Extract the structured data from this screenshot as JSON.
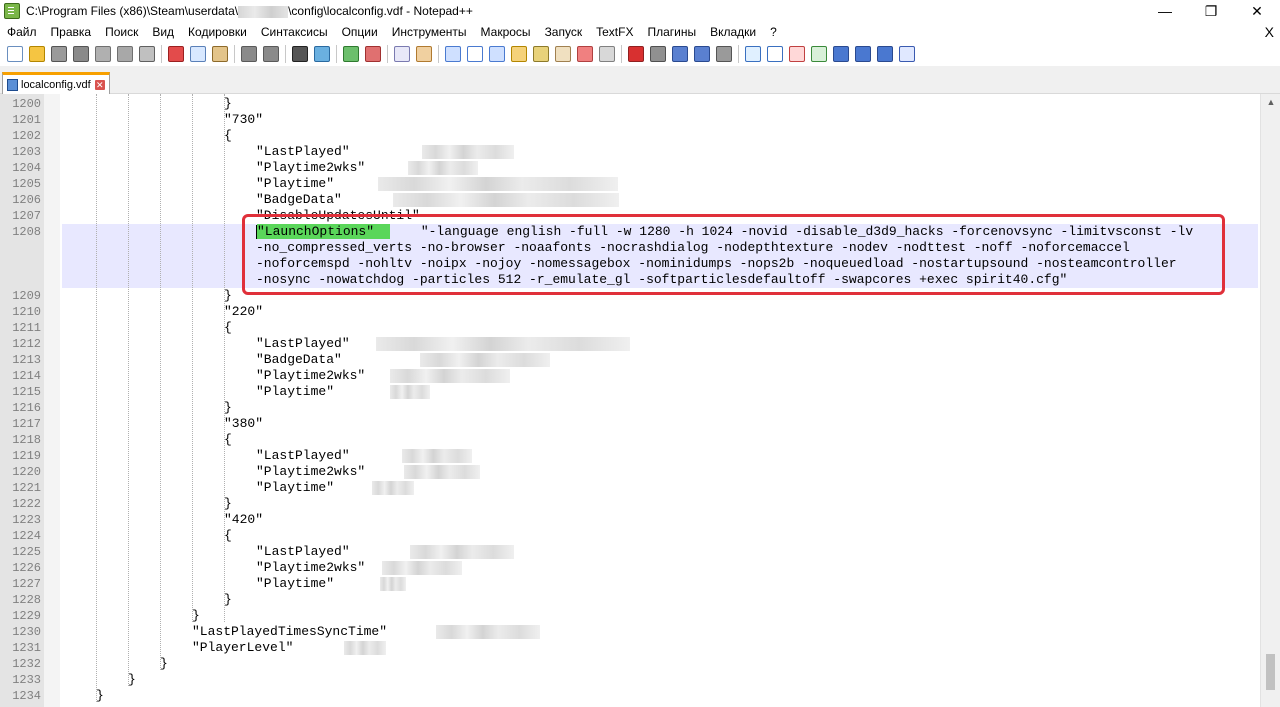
{
  "window": {
    "title_prefix": "C:\\Program Files (x86)\\Steam\\userdata\\",
    "title_suffix": "\\config\\localconfig.vdf - Notepad++",
    "minimize": "—",
    "maximize": "❐",
    "close": "✕"
  },
  "menu": {
    "items": [
      "Файл",
      "Правка",
      "Поиск",
      "Вид",
      "Кодировки",
      "Синтаксисы",
      "Опции",
      "Инструменты",
      "Макросы",
      "Запуск",
      "TextFX",
      "Плагины",
      "Вкладки",
      "?"
    ],
    "close_doc": "X"
  },
  "toolbar": {
    "icons": [
      {
        "name": "new-file-icon",
        "color": "#ffffff",
        "border": "#6a8fbf"
      },
      {
        "name": "open-file-icon",
        "color": "#f5c542",
        "border": "#b38600"
      },
      {
        "name": "save-icon",
        "color": "#9a9a9a",
        "border": "#555555"
      },
      {
        "name": "save-all-icon",
        "color": "#8a8a8a",
        "border": "#555555"
      },
      {
        "name": "close-file-icon",
        "color": "#b0b0b0",
        "border": "#707070"
      },
      {
        "name": "close-all-icon",
        "color": "#a8a8a8",
        "border": "#707070"
      },
      {
        "name": "print-icon",
        "color": "#c0c0c0",
        "border": "#606060"
      },
      "sep",
      {
        "name": "cut-icon",
        "color": "#e34b4b",
        "border": "#9b2020"
      },
      {
        "name": "copy-icon",
        "color": "#d8e8ff",
        "border": "#5a80b8"
      },
      {
        "name": "paste-icon",
        "color": "#e3c48a",
        "border": "#8d6a2a"
      },
      "sep",
      {
        "name": "undo-icon",
        "color": "#8a8a8a",
        "border": "#5a5a5a"
      },
      {
        "name": "redo-icon",
        "color": "#8a8a8a",
        "border": "#5a5a5a"
      },
      "sep",
      {
        "name": "find-icon",
        "color": "#555555",
        "border": "#222222"
      },
      {
        "name": "replace-icon",
        "color": "#6ab0e0",
        "border": "#2a6aa0"
      },
      "sep",
      {
        "name": "zoom-in-icon",
        "color": "#6cbf6c",
        "border": "#2f7a2f"
      },
      {
        "name": "zoom-out-icon",
        "color": "#e07070",
        "border": "#a03030"
      },
      "sep",
      {
        "name": "sync-vertical-icon",
        "color": "#e8e8f8",
        "border": "#7a7ab0"
      },
      {
        "name": "sync-horizontal-icon",
        "color": "#f0d0a0",
        "border": "#b07a30"
      },
      "sep",
      {
        "name": "word-wrap-icon",
        "color": "#cfe0ff",
        "border": "#4a7ad0"
      },
      {
        "name": "show-all-chars-icon",
        "color": "#ffffff",
        "border": "#4a7ad0"
      },
      {
        "name": "indent-guide-icon",
        "color": "#cfe0ff",
        "border": "#4a7ad0"
      },
      {
        "name": "udl-icon",
        "color": "#f5d27a",
        "border": "#b38600"
      },
      {
        "name": "doc-map-icon",
        "color": "#e8d27a",
        "border": "#8d7a2a"
      },
      {
        "name": "function-list-icon",
        "color": "#f0e0c0",
        "border": "#a08050"
      },
      {
        "name": "folder-workspace-icon",
        "color": "#f08080",
        "border": "#b04040"
      },
      {
        "name": "monitor-icon",
        "color": "#d8d8d8",
        "border": "#808080"
      },
      "sep",
      {
        "name": "record-macro-icon",
        "color": "#d83030",
        "border": "#902020"
      },
      {
        "name": "stop-macro-icon",
        "color": "#909090",
        "border": "#505050"
      },
      {
        "name": "play-macro-icon",
        "color": "#5a80d0",
        "border": "#2a4a90"
      },
      {
        "name": "play-multiple-icon",
        "color": "#5a80d0",
        "border": "#2a4a90"
      },
      {
        "name": "save-macro-icon",
        "color": "#9a9a9a",
        "border": "#555555"
      },
      "sep",
      {
        "name": "textfx-1-icon",
        "color": "#e0f0ff",
        "border": "#3a70c0"
      },
      {
        "name": "textfx-2-icon",
        "color": "#ffffff",
        "border": "#3a70c0"
      },
      {
        "name": "textfx-3-icon",
        "color": "#ffd8d8",
        "border": "#c04040"
      },
      {
        "name": "textfx-4-icon",
        "color": "#d8f0d8",
        "border": "#3a8a3a"
      },
      {
        "name": "arrow-up-icon",
        "color": "#4a78d0",
        "border": "#2a4a90"
      },
      {
        "name": "arrow-down-icon",
        "color": "#4a78d0",
        "border": "#2a4a90"
      },
      {
        "name": "sort-icon",
        "color": "#4a78d0",
        "border": "#2a4a90"
      },
      {
        "name": "columns-icon",
        "color": "#e0e8ff",
        "border": "#3a5ab0"
      }
    ]
  },
  "tab": {
    "label": "localconfig.vdf",
    "close": "✕"
  },
  "editor": {
    "lines": [
      {
        "no": "1200",
        "text": "}",
        "indent": 5
      },
      {
        "no": "1201",
        "text": "\"730\"",
        "indent": 5
      },
      {
        "no": "1202",
        "text": "{",
        "indent": 5
      },
      {
        "no": "1203",
        "text": "\"LastPlayed\"",
        "indent": 6
      },
      {
        "no": "1204",
        "text": "\"Playtime2wks\"",
        "indent": 6
      },
      {
        "no": "1205",
        "text": "\"Playtime\"",
        "indent": 6
      },
      {
        "no": "1206",
        "text": "\"BadgeData\"",
        "indent": 6
      },
      {
        "no": "1207",
        "text": "\"DisableUpdatesUntil\"",
        "indent": 6
      },
      {
        "no": "1208",
        "text": "",
        "indent": 6
      },
      {
        "no": "",
        "text": "",
        "indent": 6
      },
      {
        "no": "",
        "text": "",
        "indent": 6
      },
      {
        "no": "",
        "text": "",
        "indent": 6
      },
      {
        "no": "1209",
        "text": "}",
        "indent": 5
      },
      {
        "no": "1210",
        "text": "\"220\"",
        "indent": 5
      },
      {
        "no": "1211",
        "text": "{",
        "indent": 5
      },
      {
        "no": "1212",
        "text": "\"LastPlayed\"",
        "indent": 6
      },
      {
        "no": "1213",
        "text": "\"BadgeData\"",
        "indent": 6
      },
      {
        "no": "1214",
        "text": "\"Playtime2wks\"",
        "indent": 6
      },
      {
        "no": "1215",
        "text": "\"Playtime\"",
        "indent": 6
      },
      {
        "no": "1216",
        "text": "}",
        "indent": 5
      },
      {
        "no": "1217",
        "text": "\"380\"",
        "indent": 5
      },
      {
        "no": "1218",
        "text": "{",
        "indent": 5
      },
      {
        "no": "1219",
        "text": "\"LastPlayed\"",
        "indent": 6
      },
      {
        "no": "1220",
        "text": "\"Playtime2wks\"",
        "indent": 6
      },
      {
        "no": "1221",
        "text": "\"Playtime\"",
        "indent": 6
      },
      {
        "no": "1222",
        "text": "}",
        "indent": 5
      },
      {
        "no": "1223",
        "text": "\"420\"",
        "indent": 5
      },
      {
        "no": "1224",
        "text": "{",
        "indent": 5
      },
      {
        "no": "1225",
        "text": "\"LastPlayed\"",
        "indent": 6
      },
      {
        "no": "1226",
        "text": "\"Playtime2wks\"",
        "indent": 6
      },
      {
        "no": "1227",
        "text": "\"Playtime\"",
        "indent": 6
      },
      {
        "no": "1228",
        "text": "}",
        "indent": 5
      },
      {
        "no": "1229",
        "text": "}",
        "indent": 4
      },
      {
        "no": "1230",
        "text": "\"LastPlayedTimesSyncTime\"",
        "indent": 4
      },
      {
        "no": "1231",
        "text": "\"PlayerLevel\"",
        "indent": 4
      },
      {
        "no": "1232",
        "text": "}",
        "indent": 3
      },
      {
        "no": "1233",
        "text": "}",
        "indent": 2
      },
      {
        "no": "1234",
        "text": "}",
        "indent": 1
      }
    ],
    "launch_key": "\"LaunchOptions\"",
    "launch_value_lines": [
      "\"-language english -full -w 1280 -h 1024 -novid -disable_d3d9_hacks -forcenovsync -limitvsconst -lv",
      "-no_compressed_verts -no-browser -noaafonts -nocrashdialog -nodepthtexture -nodev -nodttest -noff -noforcemaccel",
      "-noforcemspd -nohltv -noipx -nojoy -nomessagebox -nominidumps -nops2b -noqueuedload -nostartupsound -nosteamcontroller",
      "-nosync -nowatchdog -particles 512 -r_emulate_gl -softparticlesdefaultoff -swapcores +exec spirit40.cfg\""
    ],
    "colors": {
      "key_highlight": "#5ad65a",
      "wrap_line_bg": "#e8e8ff",
      "annotation": "#e0303a",
      "tab_accent": "#f7a000"
    }
  }
}
